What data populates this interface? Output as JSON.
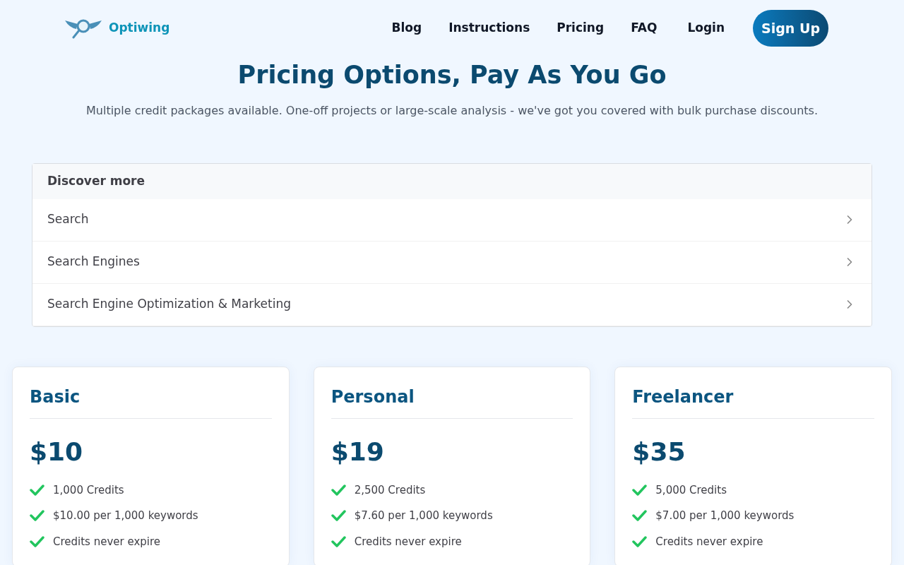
{
  "brand": "Optiwing",
  "nav": [
    {
      "label": "Blog"
    },
    {
      "label": "Instructions"
    },
    {
      "label": "Pricing"
    },
    {
      "label": "FAQ"
    }
  ],
  "login": "Login",
  "signup": "Sign Up",
  "heading": "Pricing Options, Pay As You Go",
  "subheading": "Multiple credit packages available. One-off projects or large-scale analysis - we've got you covered with bulk purchase discounts.",
  "discover": {
    "title": "Discover more",
    "items": [
      {
        "label": "Search"
      },
      {
        "label": "Search Engines"
      },
      {
        "label": "Search Engine Optimization & Marketing"
      }
    ]
  },
  "plans": [
    {
      "name": "Basic",
      "price": "$10",
      "features": [
        "1,000 Credits",
        "$10.00 per 1,000 keywords",
        "Credits never expire"
      ]
    },
    {
      "name": "Personal",
      "price": "$19",
      "features": [
        "2,500 Credits",
        "$7.60 per 1,000 keywords",
        "Credits never expire"
      ]
    },
    {
      "name": "Freelancer",
      "price": "$35",
      "features": [
        "5,000 Credits",
        "$7.00 per 1,000 keywords",
        "Credits never expire"
      ]
    }
  ]
}
